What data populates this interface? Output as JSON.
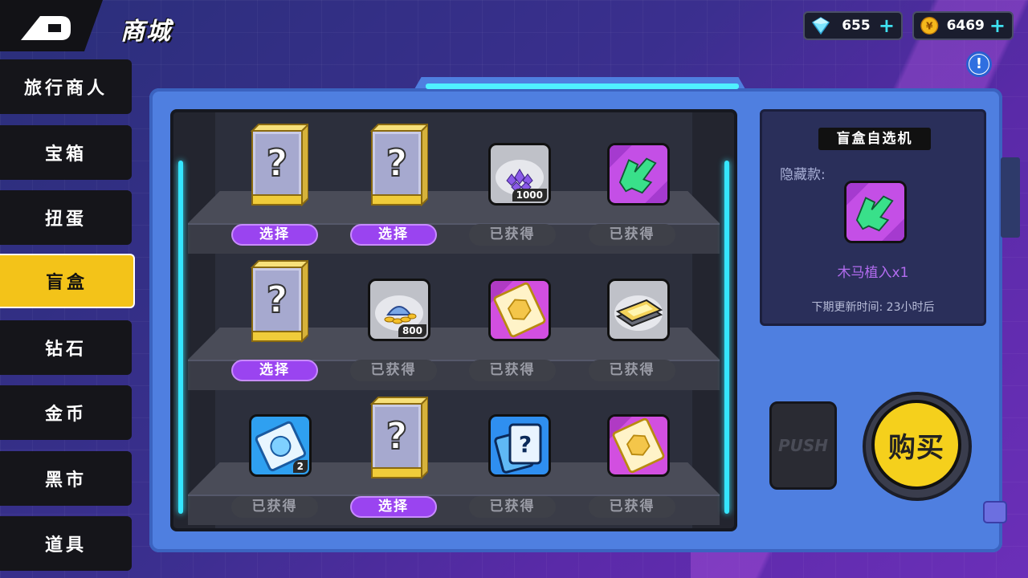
{
  "header": {
    "back_icon": "back-arrow-icon",
    "title": "商城",
    "gems": {
      "value": "655",
      "icon": "diamond-icon",
      "add": "+"
    },
    "coins": {
      "value": "6469",
      "icon": "coin-icon",
      "coin_symbol": "¥",
      "add": "+"
    },
    "help_glyph": "!"
  },
  "sidebar": {
    "items": [
      {
        "label": "旅行商人"
      },
      {
        "label": "宝箱"
      },
      {
        "label": "扭蛋"
      },
      {
        "label": "盲盒",
        "active": true
      },
      {
        "label": "钻石"
      },
      {
        "label": "金币"
      },
      {
        "label": "黑市"
      },
      {
        "label": "道具"
      }
    ]
  },
  "shelf": {
    "slots": [
      {
        "icon": "mystery-box-icon",
        "button": "选择",
        "state": "select"
      },
      {
        "icon": "mystery-box-icon",
        "button": "选择",
        "state": "select"
      },
      {
        "icon": "purple-crystal-pile-icon",
        "qty": "1000",
        "button": "已获得",
        "state": "owned"
      },
      {
        "icon": "green-trojan-implant-icon",
        "button": "已获得",
        "state": "owned"
      },
      {
        "icon": "mystery-box-icon",
        "button": "选择",
        "state": "select"
      },
      {
        "icon": "gold-coin-pile-icon",
        "qty": "800",
        "button": "已获得",
        "state": "owned"
      },
      {
        "icon": "gold-ticket-icon",
        "button": "已获得",
        "state": "owned"
      },
      {
        "icon": "card-stack-icon",
        "button": "已获得",
        "state": "owned"
      },
      {
        "icon": "blue-ticket-icon",
        "qty": "2",
        "button": "已获得",
        "state": "owned"
      },
      {
        "icon": "mystery-box-icon",
        "button": "选择",
        "state": "select"
      },
      {
        "icon": "mystery-card-icon",
        "question": "?",
        "button": "已获得",
        "state": "owned"
      },
      {
        "icon": "gold-ticket-icon",
        "button": "已获得",
        "state": "owned"
      }
    ]
  },
  "info": {
    "title": "盲盒自选机",
    "hidden_label": "隐藏款:",
    "hidden_icon": "green-trojan-implant-icon",
    "reward": "木马植入x1",
    "refresh": "下期更新时间: 23小时后"
  },
  "controls": {
    "push_label": "PUSH",
    "buy_label": "购买"
  },
  "colors": {
    "accent_yellow": "#f3c319",
    "select_purple": "#9a44f0",
    "neon_cyan": "#35e6ff",
    "panel_blue": "#4f7fe0"
  }
}
